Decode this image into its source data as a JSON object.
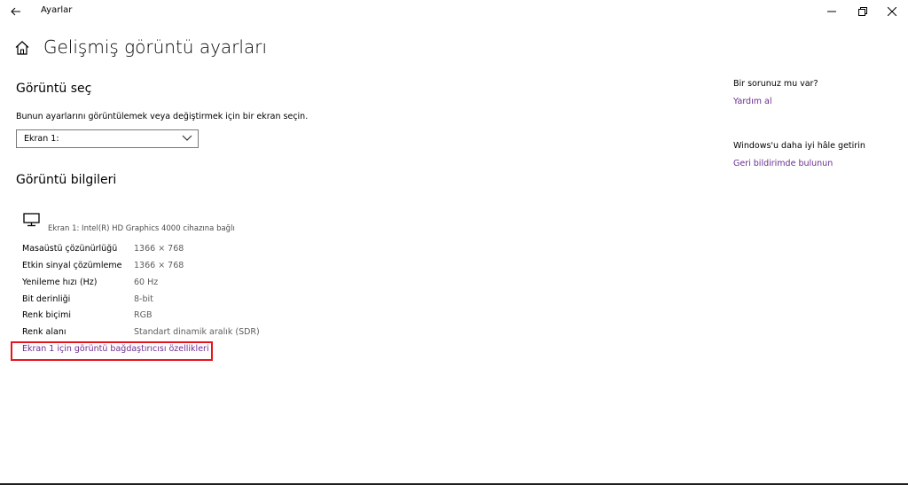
{
  "window": {
    "title": "Ayarlar",
    "back_icon": "back-arrow-icon",
    "minimize_icon": "minimize-icon",
    "restore_icon": "restore-icon",
    "close_icon": "close-icon"
  },
  "page": {
    "home_icon": "home-icon",
    "title": "Gelişmiş görüntü ayarları"
  },
  "select_display": {
    "heading": "Görüntü seç",
    "description": "Bunun ayarlarını görüntülemek veya değiştirmek için bir ekran seçin.",
    "dropdown_value": "Ekran 1:",
    "dropdown_icon": "chevron-down-icon"
  },
  "display_info": {
    "heading": "Görüntü bilgileri",
    "monitor_icon": "monitor-icon",
    "adapter_text": "Ekran 1: Intel(R) HD Graphics 4000 cihazına bağlı",
    "rows": [
      {
        "label": "Masaüstü çözünürlüğü",
        "value": "1366 × 768"
      },
      {
        "label": "Etkin sinyal çözümleme",
        "value": "1366 × 768"
      },
      {
        "label": "Yenileme hızı (Hz)",
        "value": "60 Hz"
      },
      {
        "label": "Bit derinliği",
        "value": "8-bit"
      },
      {
        "label": "Renk biçimi",
        "value": "RGB"
      },
      {
        "label": "Renk alanı",
        "value": "Standart dinamik aralık (SDR)"
      }
    ],
    "adapter_link": "Ekran 1 için görüntü bağdaştırıcısı özellikleri"
  },
  "sidebar": {
    "help_heading": "Bir sorunuz mu var?",
    "help_link": "Yardım al",
    "feedback_heading": "Windows'u daha iyi hâle getirin",
    "feedback_link": "Geri bildirimde bulunun"
  },
  "colors": {
    "link": "#6b2c91",
    "highlight": "#e8141c",
    "value_text": "#5d5d5d"
  }
}
